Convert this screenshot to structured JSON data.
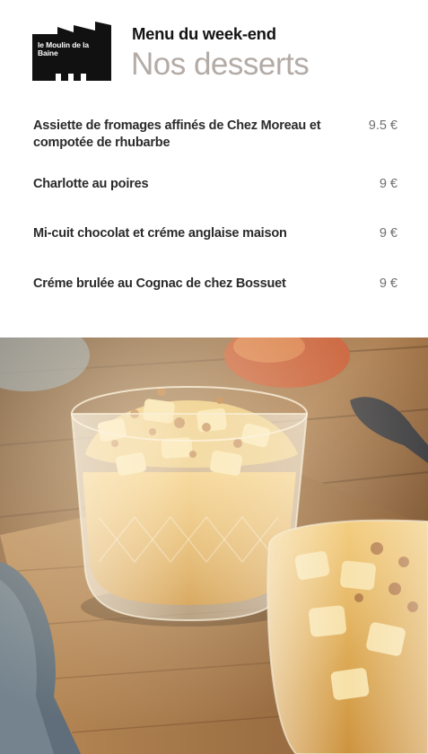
{
  "brand": {
    "logo_text": "le Moulin de la Baine",
    "logo_color": "#111111"
  },
  "header": {
    "kicker": "Menu du week-end",
    "title": "Nos desserts"
  },
  "menu": {
    "items": [
      {
        "name": "Assiette de fromages affinés  de Chez Moreau et compotée de rhubarbe",
        "price": "9.5 €"
      },
      {
        "name": "Charlotte au poires",
        "price": "9 €"
      },
      {
        "name": "Mi-cuit chocolat et créme anglaise maison",
        "price": "9 €"
      },
      {
        "name": "Créme brulée au Cognac de chez Bossuet",
        "price": "9 €"
      }
    ]
  },
  "photo": {
    "subject": "dessert-glasses-on-wooden-board"
  }
}
